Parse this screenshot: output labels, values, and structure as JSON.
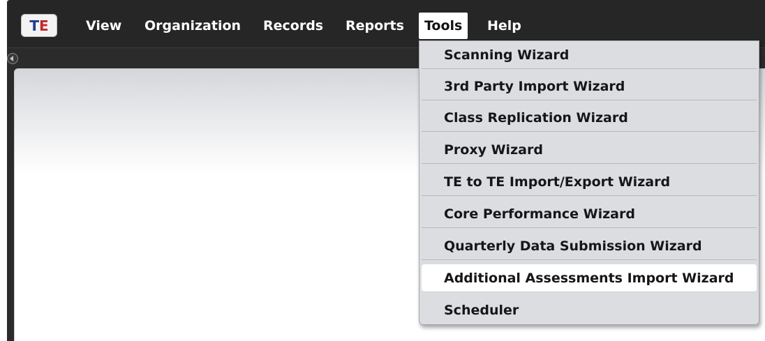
{
  "app": {
    "logo_text": "TE"
  },
  "menubar": {
    "items": [
      {
        "label": "View"
      },
      {
        "label": "Organization"
      },
      {
        "label": "Records"
      },
      {
        "label": "Reports"
      },
      {
        "label": "Tools",
        "active": true
      },
      {
        "label": "Help"
      }
    ]
  },
  "tools_menu": {
    "items": [
      {
        "label": "Scanning Wizard"
      },
      {
        "label": "3rd Party Import Wizard"
      },
      {
        "label": "Class Replication Wizard"
      },
      {
        "label": "Proxy Wizard"
      },
      {
        "label": "TE to TE Import/Export Wizard"
      },
      {
        "label": "Core Performance Wizard"
      },
      {
        "label": "Quarterly Data Submission Wizard"
      },
      {
        "label": "Additional Assessments Import Wizard",
        "highlighted": true
      },
      {
        "label": "Scheduler"
      }
    ]
  },
  "colors": {
    "menubar_bg": "#262626",
    "dropdown_bg": "#dcdde1",
    "highlight_bg": "#ffffff",
    "logo_blue": "#1d3d8f",
    "logo_red": "#c0282d"
  },
  "icons": {
    "collapse": "chevron-left-circle-icon"
  }
}
